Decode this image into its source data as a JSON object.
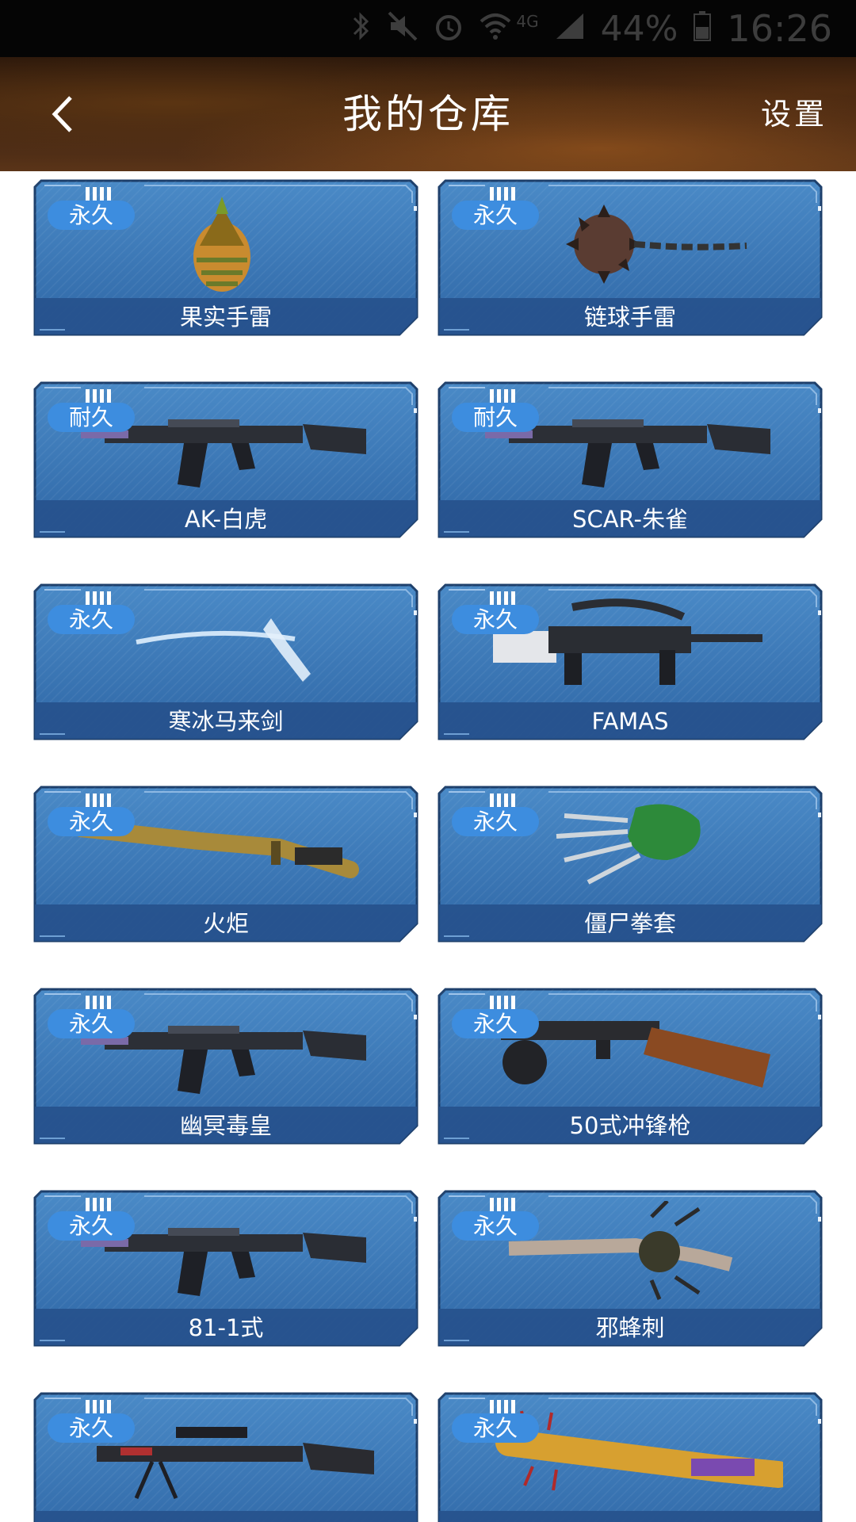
{
  "status_bar": {
    "network": "4G",
    "battery": "44%",
    "time": "16:26",
    "icons": [
      "bluetooth-icon",
      "mute-icon",
      "alarm-icon",
      "wifi-icon",
      "signal-icon",
      "battery-icon"
    ]
  },
  "header": {
    "back_icon": "chevron-left-icon",
    "title": "我的仓库",
    "settings_label": "设置"
  },
  "colors": {
    "card_blue": "#3a77b6",
    "card_name_band": "#27528d",
    "badge_blue": "#3d8ddf",
    "header_brown": "#3c2212"
  },
  "items": [
    {
      "name": "果实手雷",
      "badge": "永久",
      "icon": "fruit-grenade-icon"
    },
    {
      "name": "链球手雷",
      "badge": "永久",
      "icon": "spiked-ball-grenade-icon"
    },
    {
      "name": "AK-白虎",
      "badge": "耐久",
      "icon": "rifle-icon"
    },
    {
      "name": "SCAR-朱雀",
      "badge": "耐久",
      "icon": "rifle-icon"
    },
    {
      "name": "寒冰马来剑",
      "badge": "永久",
      "icon": "ice-sword-icon"
    },
    {
      "name": "FAMAS",
      "badge": "永久",
      "icon": "bullpup-rifle-icon"
    },
    {
      "name": "火炬",
      "badge": "永久",
      "icon": "torch-icon"
    },
    {
      "name": "僵尸拳套",
      "badge": "永久",
      "icon": "zombie-claw-icon"
    },
    {
      "name": "幽冥毒皇",
      "badge": "永久",
      "icon": "rifle-icon"
    },
    {
      "name": "50式冲锋枪",
      "badge": "永久",
      "icon": "submachine-gun-icon"
    },
    {
      "name": "81-1式",
      "badge": "永久",
      "icon": "rifle-icon"
    },
    {
      "name": "邪蜂刺",
      "badge": "永久",
      "icon": "spiked-blade-icon"
    },
    {
      "name": "",
      "badge": "永久",
      "icon": "sniper-rifle-icon"
    },
    {
      "name": "",
      "badge": "永久",
      "icon": "spiked-bat-icon"
    }
  ]
}
